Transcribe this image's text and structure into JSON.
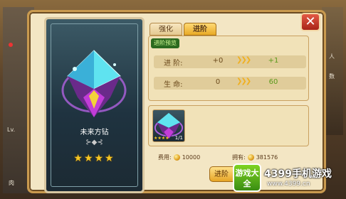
{
  "tabs": {
    "enhance": "强化",
    "advance": "进阶"
  },
  "badge": "进阶预览",
  "stats": [
    {
      "label": "进    阶:",
      "current": "+0",
      "next": "+1"
    },
    {
      "label": "生    命:",
      "current": "0",
      "next": "60"
    }
  ],
  "card": {
    "name": "未来方钻",
    "stars": "★★★★",
    "ornament": "⊱◆⊰"
  },
  "material": {
    "stars": "★★★★",
    "count": "1/1"
  },
  "cost": {
    "label": "费用:",
    "value": "10000"
  },
  "owned": {
    "label": "拥有:",
    "value": "381576"
  },
  "advance_button": "进阶",
  "close": "✕",
  "left_hud": {
    "label_a": "Lv.",
    "label_b": "肉"
  },
  "right_hud": {
    "label_a": "人",
    "label_b": "数"
  },
  "watermark": {
    "logo": "游戏大全",
    "title": "4399手机游戏",
    "url": "www.4399.cn"
  },
  "colors": {
    "advance_tab": "#e8a926",
    "close": "#c63a28",
    "positive": "#5b9a1c",
    "star": "#f5c623"
  }
}
